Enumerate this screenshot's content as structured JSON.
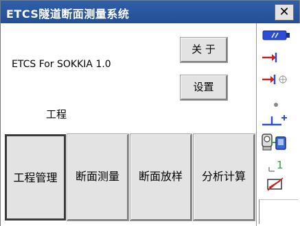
{
  "window": {
    "title": "ETCS隧道断面测量系统",
    "close_label": "✕"
  },
  "info": {
    "app_version": "ETCS For SOKKIA 1.0"
  },
  "buttons": {
    "about": "关 于",
    "settings": "设置"
  },
  "section": {
    "label": "工程"
  },
  "main_buttons": [
    {
      "label": "工程管理",
      "selected": true
    },
    {
      "label": "断面测量",
      "selected": false
    },
    {
      "label": "断面放样",
      "selected": false
    },
    {
      "label": "分析计算",
      "selected": false
    }
  ],
  "sidebar": {
    "icons": [
      "battery-icon",
      "target-arrow-icon",
      "target-prism-icon",
      "dot-icon",
      "instrument-height-icon",
      "instrument-device-icon",
      "signal-level-icon",
      "tilt-off-icon"
    ],
    "signal_level": "1",
    "colors": {
      "battery": "#2a4fd6",
      "arrow": "#cc1f1f",
      "target": "#3a6ad6"
    }
  }
}
